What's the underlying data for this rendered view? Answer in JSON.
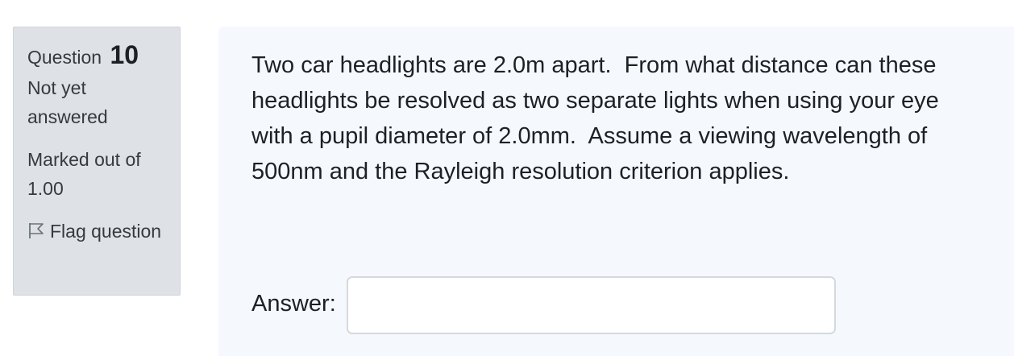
{
  "info": {
    "question_word": "Question",
    "question_number": "10",
    "state": "Not yet answered",
    "grade": "Marked out of 1.00",
    "flag_label": "Flag question",
    "flag_icon": "flag-outline-icon"
  },
  "question": {
    "text": "Two car headlights are 2.0m apart.  From what distance can these headlights be resolved as two separate lights when using your eye with a pupil diameter of 2.0mm.  Assume a viewing wavelength of 500nm and the Rayleigh resolution criterion applies.",
    "answer_label": "Answer:",
    "answer_value": "",
    "answer_placeholder": ""
  },
  "colors": {
    "info_background": "#dee2e6",
    "content_background": "#f5f9fe",
    "text": "#1d2125"
  }
}
